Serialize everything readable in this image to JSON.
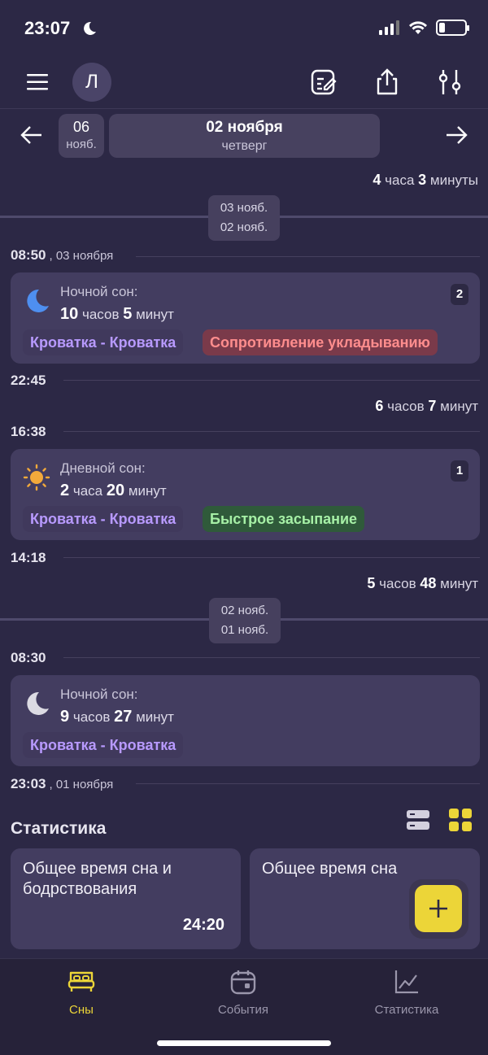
{
  "status_bar": {
    "time": "23:07",
    "battery_level": 0.2
  },
  "header": {
    "avatar_letter": "Л"
  },
  "date_nav": {
    "prev_day": "06",
    "prev_month": "нояб.",
    "current_date": "02 ноября",
    "current_weekday": "четверг"
  },
  "timeline": {
    "gap1": {
      "h": "4",
      "h_unit": "часа",
      "m": "3",
      "m_unit": "минуты"
    },
    "divider1": {
      "top": "03 нояб.",
      "bottom": "02 нояб."
    },
    "t1": {
      "time": "08:50",
      "date": ", 03 ноября"
    },
    "card1": {
      "title": "Ночной сон:",
      "h": "10",
      "h_unit": "часов",
      "m": "5",
      "m_unit": "минут",
      "place": "Кроватка - Кроватка",
      "tag": "Сопротивление укладыванию",
      "badge": "2",
      "icon": "moon-icon"
    },
    "t2": {
      "time": "22:45"
    },
    "gap2": {
      "h": "6",
      "h_unit": "часов",
      "m": "7",
      "m_unit": "минут"
    },
    "t3": {
      "time": "16:38"
    },
    "card2": {
      "title": "Дневной сон:",
      "h": "2",
      "h_unit": "часа",
      "m": "20",
      "m_unit": "минут",
      "place": "Кроватка - Кроватка",
      "tag": "Быстрое засыпание",
      "badge": "1",
      "icon": "sun-icon"
    },
    "t4": {
      "time": "14:18"
    },
    "gap3": {
      "h": "5",
      "h_unit": "часов",
      "m": "48",
      "m_unit": "минут"
    },
    "divider2": {
      "top": "02 нояб.",
      "bottom": "01 нояб."
    },
    "t5": {
      "time": "08:30"
    },
    "card3": {
      "title": "Ночной сон:",
      "h": "9",
      "h_unit": "часов",
      "m": "27",
      "m_unit": "минут",
      "place": "Кроватка - Кроватка",
      "icon": "moon-icon"
    },
    "t6": {
      "time": "23:03",
      "date": ", 01 ноября"
    }
  },
  "stats": {
    "title": "Статистика",
    "cards": [
      {
        "label": "Общее время сна и бодрствования",
        "value": "24:20"
      },
      {
        "label": "Общее время сна",
        "value": ""
      }
    ]
  },
  "bottom_nav": {
    "items": [
      {
        "label": "Сны",
        "active": true
      },
      {
        "label": "События",
        "active": false
      },
      {
        "label": "Статистика",
        "active": false
      }
    ]
  },
  "colors": {
    "background": "#2c2845",
    "card": "#433d60",
    "accent": "#ecd538",
    "place_chip_text": "#b89aff",
    "negative_tag": "#7a3a4a",
    "positive_tag": "#2f5a3a"
  }
}
